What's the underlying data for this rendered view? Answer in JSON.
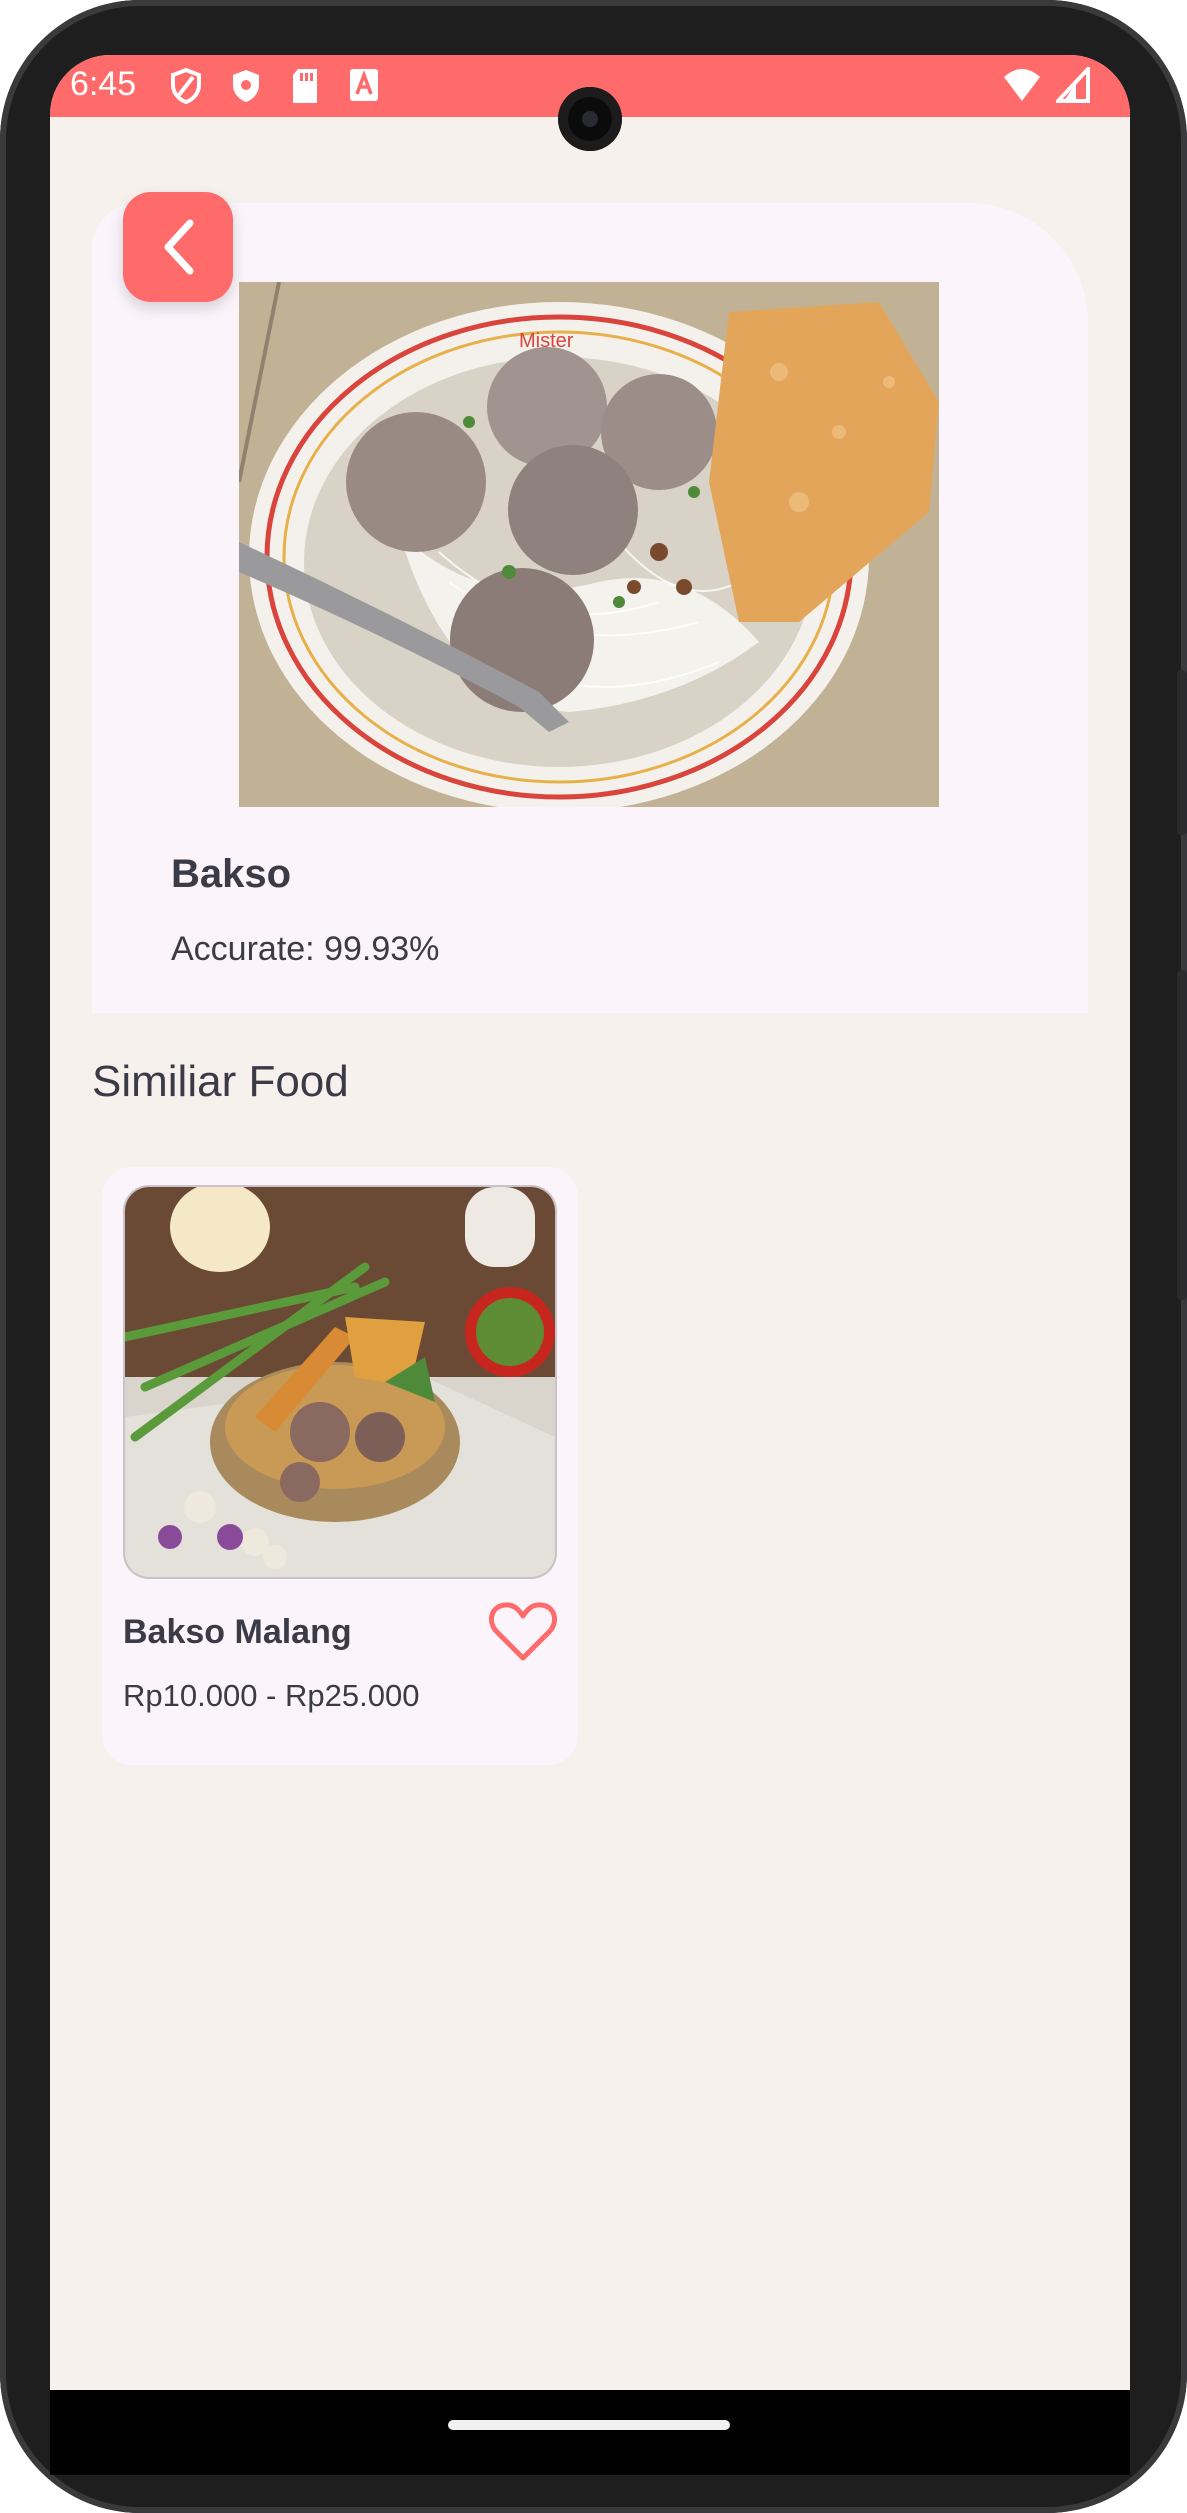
{
  "status_bar": {
    "time": "6:45"
  },
  "result": {
    "name": "Bakso",
    "accuracy": "Accurate: 99.93%"
  },
  "section_title": "Similiar Food",
  "similar": [
    {
      "name": "Bakso Malang",
      "price": "Rp10.000 - Rp25.000"
    }
  ],
  "colors": {
    "accent": "#ff6b6b",
    "background": "#f7f1ee",
    "card": "#fbf4fb",
    "text": "#3b3a47"
  },
  "icons": [
    "back-chevron-icon",
    "heart-outline-icon",
    "shield-icon",
    "sd-card-icon",
    "text-a-icon",
    "wifi-icon",
    "signal-icon"
  ]
}
